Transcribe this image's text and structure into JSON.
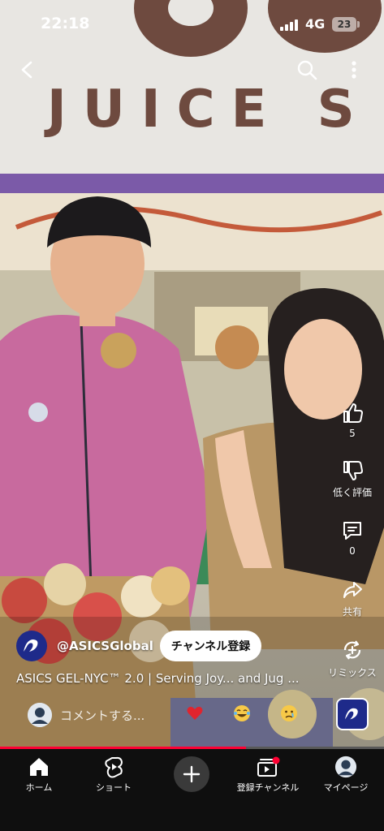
{
  "status_bar": {
    "time": "22:18",
    "network": "4G",
    "battery": "23"
  },
  "video": {
    "sign_text": "JUICE S",
    "channel_handle": "@ASICSGlobal",
    "subscribe_label": "チャンネル登録",
    "title": "ASICS GEL-NYC™ 2.0 | Serving Joy... and Jug ...",
    "progress_percent": 64
  },
  "actions": {
    "like_count": "5",
    "dislike_label": "低く評価",
    "comment_count": "0",
    "share_label": "共有",
    "remix_label": "リミックス"
  },
  "comment_bar": {
    "placeholder": "コメントする...",
    "quick_emojis": [
      "heart",
      "face-with-tears-of-joy",
      "crying-face"
    ]
  },
  "bottom_nav": {
    "items": [
      {
        "label": "ホーム",
        "icon": "home-icon"
      },
      {
        "label": "ショート",
        "icon": "shorts-icon"
      },
      {
        "label": "",
        "icon": "plus-icon"
      },
      {
        "label": "登録チャンネル",
        "icon": "subscriptions-icon"
      },
      {
        "label": "マイページ",
        "icon": "avatar"
      }
    ]
  },
  "colors": {
    "accent": "#ff0033",
    "nav_bg": "#0f0f0f",
    "brand": "#1e2a8a"
  }
}
